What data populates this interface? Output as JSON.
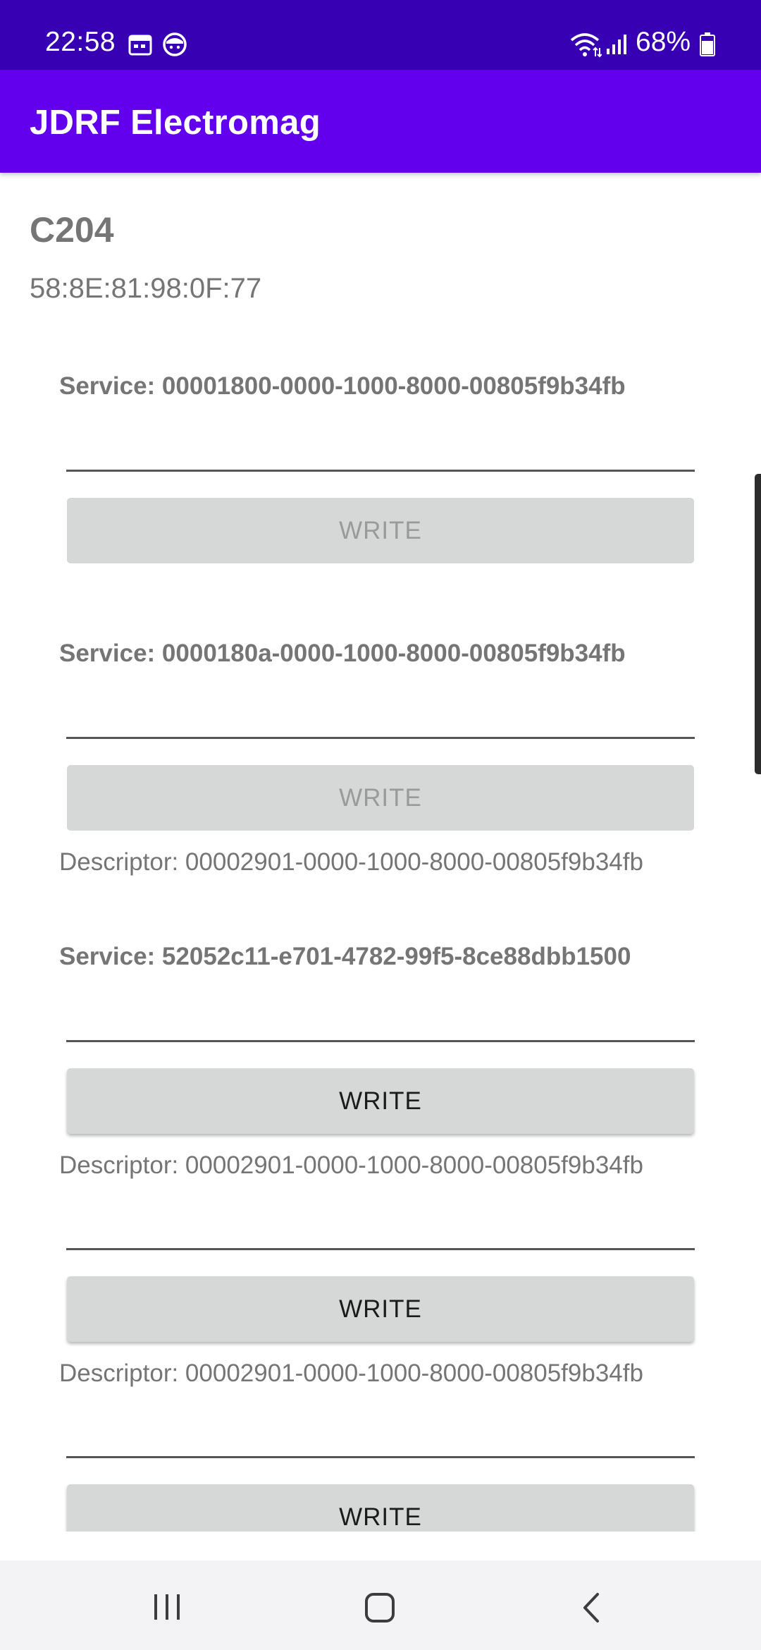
{
  "status_bar": {
    "time": "22:58",
    "battery": "68%",
    "icons": [
      "calendar-icon",
      "notification-face-icon",
      "wifi-icon",
      "cellular-signal-icon",
      "battery-icon"
    ]
  },
  "app_bar": {
    "title": "JDRF Electromag"
  },
  "device": {
    "name": "C204",
    "address": "58:8E:81:98:0F:77"
  },
  "rows": [
    {
      "service": "Service: 00001800-0000-1000-8000-00805f9b34fb",
      "write_label": "WRITE",
      "enabled": false
    },
    {
      "service": "Service: 0000180a-0000-1000-8000-00805f9b34fb",
      "write_label": "WRITE",
      "enabled": false,
      "descriptor": "Descriptor: 00002901-0000-1000-8000-00805f9b34fb"
    },
    {
      "service": "Service: 52052c11-e701-4782-99f5-8ce88dbb1500",
      "write_label": "WRITE",
      "enabled": true,
      "descriptor": "Descriptor: 00002901-0000-1000-8000-00805f9b34fb"
    },
    {
      "write_label": "WRITE",
      "enabled": true,
      "descriptor": "Descriptor: 00002901-0000-1000-8000-00805f9b34fb"
    },
    {
      "write_label": "WRITE",
      "enabled": true
    }
  ],
  "nav_bar": {
    "icons": [
      "recents-icon",
      "home-icon",
      "back-icon"
    ]
  },
  "colors": {
    "status_bar": "#3700b3",
    "app_bar": "#6200ee",
    "button": "#d6d7d7",
    "secondary_text": "#757575"
  }
}
